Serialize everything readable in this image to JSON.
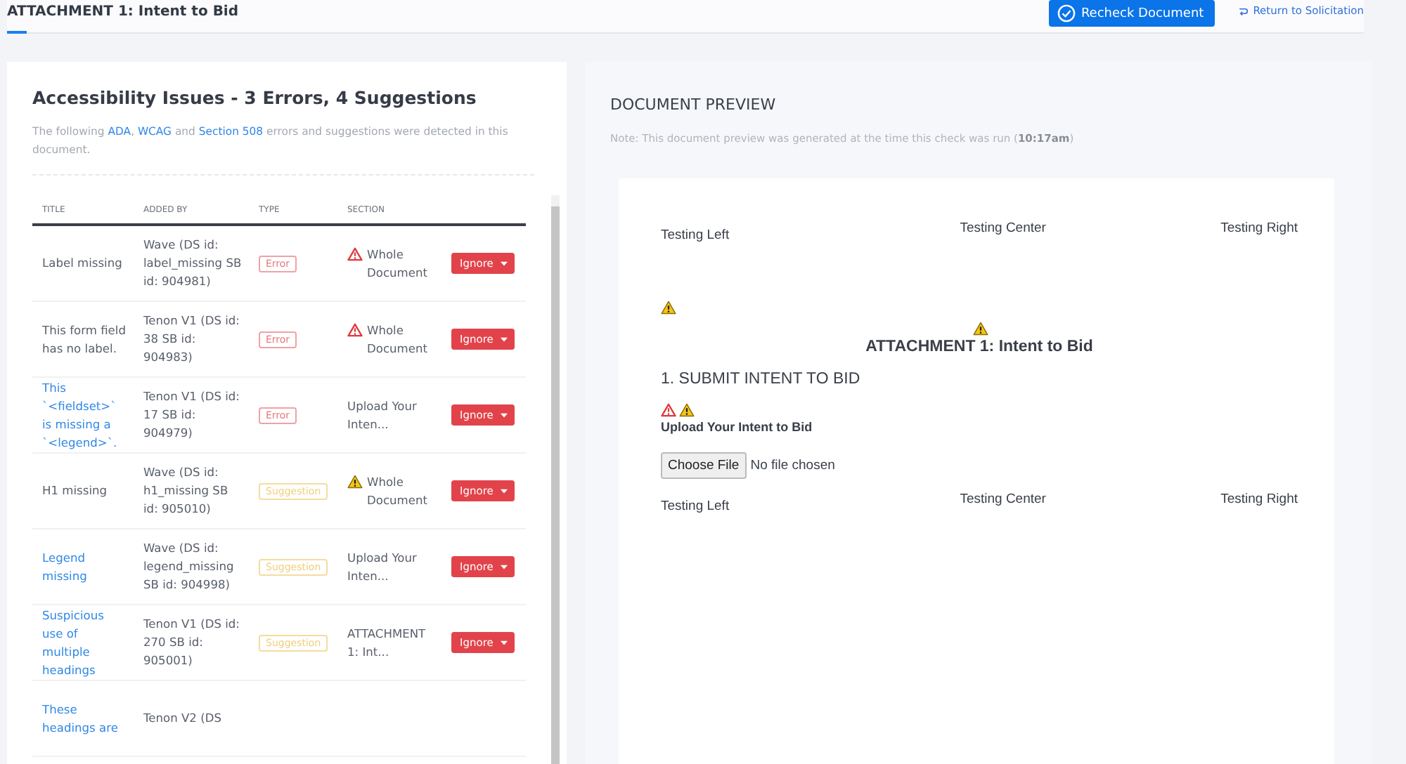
{
  "header": {
    "title": "ATTACHMENT 1: Intent to Bid",
    "recheck_button": "Recheck Document",
    "return_link": "Return to Solicitation"
  },
  "issues": {
    "heading": "Accessibility Issues - 3 Errors, 4 Suggestions",
    "intro": [
      {
        "text": "The following ",
        "link": false
      },
      {
        "text": "ADA",
        "link": true
      },
      {
        "text": ", ",
        "link": false
      },
      {
        "text": "WCAG",
        "link": true
      },
      {
        "text": " and ",
        "link": false
      },
      {
        "text": "Section 508",
        "link": true
      },
      {
        "text": " errors and suggestions were detected in this document.",
        "link": false
      }
    ],
    "columns": [
      "TITLE",
      "ADDED BY",
      "TYPE",
      "SECTION"
    ],
    "rows": [
      {
        "title": "Label missing",
        "link": false,
        "added_by": "Wave (DS id: label_missing SB id: 904981)",
        "type": "Error",
        "kind": "error",
        "section_icon": {
          "kind": "error"
        },
        "section": "Whole Document",
        "action": "Ignore"
      },
      {
        "title": "This form field has no label.",
        "link": false,
        "added_by": "Tenon V1 (DS id: 38 SB id: 904983)",
        "type": "Error",
        "kind": "error",
        "section_icon": {
          "kind": "error"
        },
        "section": "Whole Document",
        "action": "Ignore"
      },
      {
        "title": "This `<fieldset>` is missing a `<legend>`.",
        "link": true,
        "added_by": "Tenon V1 (DS id: 17 SB id: 904979)",
        "type": "Error",
        "kind": "error",
        "section": "Upload Your Inten...",
        "action": "Ignore"
      },
      {
        "title": "H1 missing",
        "link": false,
        "added_by": "Wave (DS id: h1_missing SB id: 905010)",
        "type": "Suggestion",
        "kind": "suggestion",
        "section_icon": {
          "kind": "warning"
        },
        "section": "Whole Document",
        "action": "Ignore"
      },
      {
        "title": "Legend missing",
        "link": true,
        "added_by": "Wave (DS id: legend_missing SB id: 904998)",
        "type": "Suggestion",
        "kind": "suggestion",
        "section": "Upload Your Inten...",
        "action": "Ignore"
      },
      {
        "title": "Suspicious use of multiple headings",
        "link": true,
        "added_by": "Tenon V1 (DS id: 270 SB id: 905001)",
        "type": "Suggestion",
        "kind": "suggestion",
        "section": "ATTACHMENT 1: Int...",
        "action": "Ignore"
      },
      {
        "title": "These headings are",
        "link": true,
        "added_by": "Tenon V2 (DS"
      }
    ]
  },
  "preview": {
    "title": "DOCUMENT PREVIEW",
    "note": "Note: This document preview was generated at the time this check was run (**10:17am**)",
    "document": {
      "header": {
        "left": "Testing Left",
        "center": "Testing Center",
        "right": "Testing Right"
      },
      "top_icons": [
        {
          "kind": "warning"
        }
      ],
      "title_icons": [
        {
          "kind": "warning"
        }
      ],
      "title": "ATTACHMENT 1: Intent to Bid",
      "section": "1. SUBMIT INTENT TO BID",
      "field_icons": [
        {
          "kind": "error"
        },
        {
          "kind": "warning"
        }
      ],
      "field_label": "Upload Your Intent to Bid",
      "file_button": "Choose File",
      "file_status": "No file chosen",
      "footer": {
        "left": "Testing Left",
        "center": "Testing Center",
        "right": "Testing Right"
      }
    }
  }
}
